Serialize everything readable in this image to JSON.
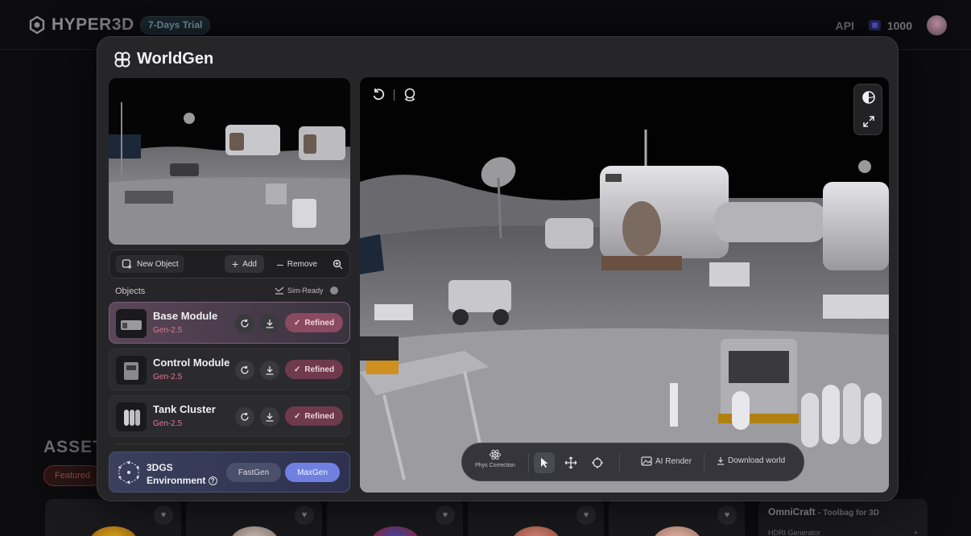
{
  "app": {
    "brand": "HYPER3D",
    "trial_badge": "7-Days Trial",
    "api_label": "API",
    "credits": "1000"
  },
  "background": {
    "assets_title": "ASSET",
    "featured_label": "Featured",
    "omni_title": "OmniCraft",
    "omni_subtitle": "- Toolbag for 3D",
    "omni_item": "HDRI Generator"
  },
  "modal": {
    "title": "WorldGen",
    "toolbar": {
      "new_object": "New Object",
      "add": "Add",
      "remove": "Remove"
    },
    "objects_label": "Objects",
    "sim_ready_label": "Sim-Ready",
    "objects": [
      {
        "name": "Base Module",
        "gen": "Gen-2.5",
        "status": "Refined"
      },
      {
        "name": "Control Module",
        "gen": "Gen-2.5",
        "status": "Refined"
      },
      {
        "name": "Tank Cluster",
        "gen": "Gen-2.5",
        "status": "Refined"
      }
    ],
    "environment": {
      "label_line1": "3DGS",
      "label_line2": "Environment",
      "fast_label": "FastGen",
      "max_label": "MaxGen"
    },
    "viewport_bar": {
      "phys_correction": "Phys Correction",
      "ai_render": "AI Render",
      "download_world": "Download world"
    }
  },
  "colors": {
    "accent_pink": "#e07890",
    "refined_bg": "#6e3a4c",
    "maxgen_bg": "#7080e0"
  }
}
